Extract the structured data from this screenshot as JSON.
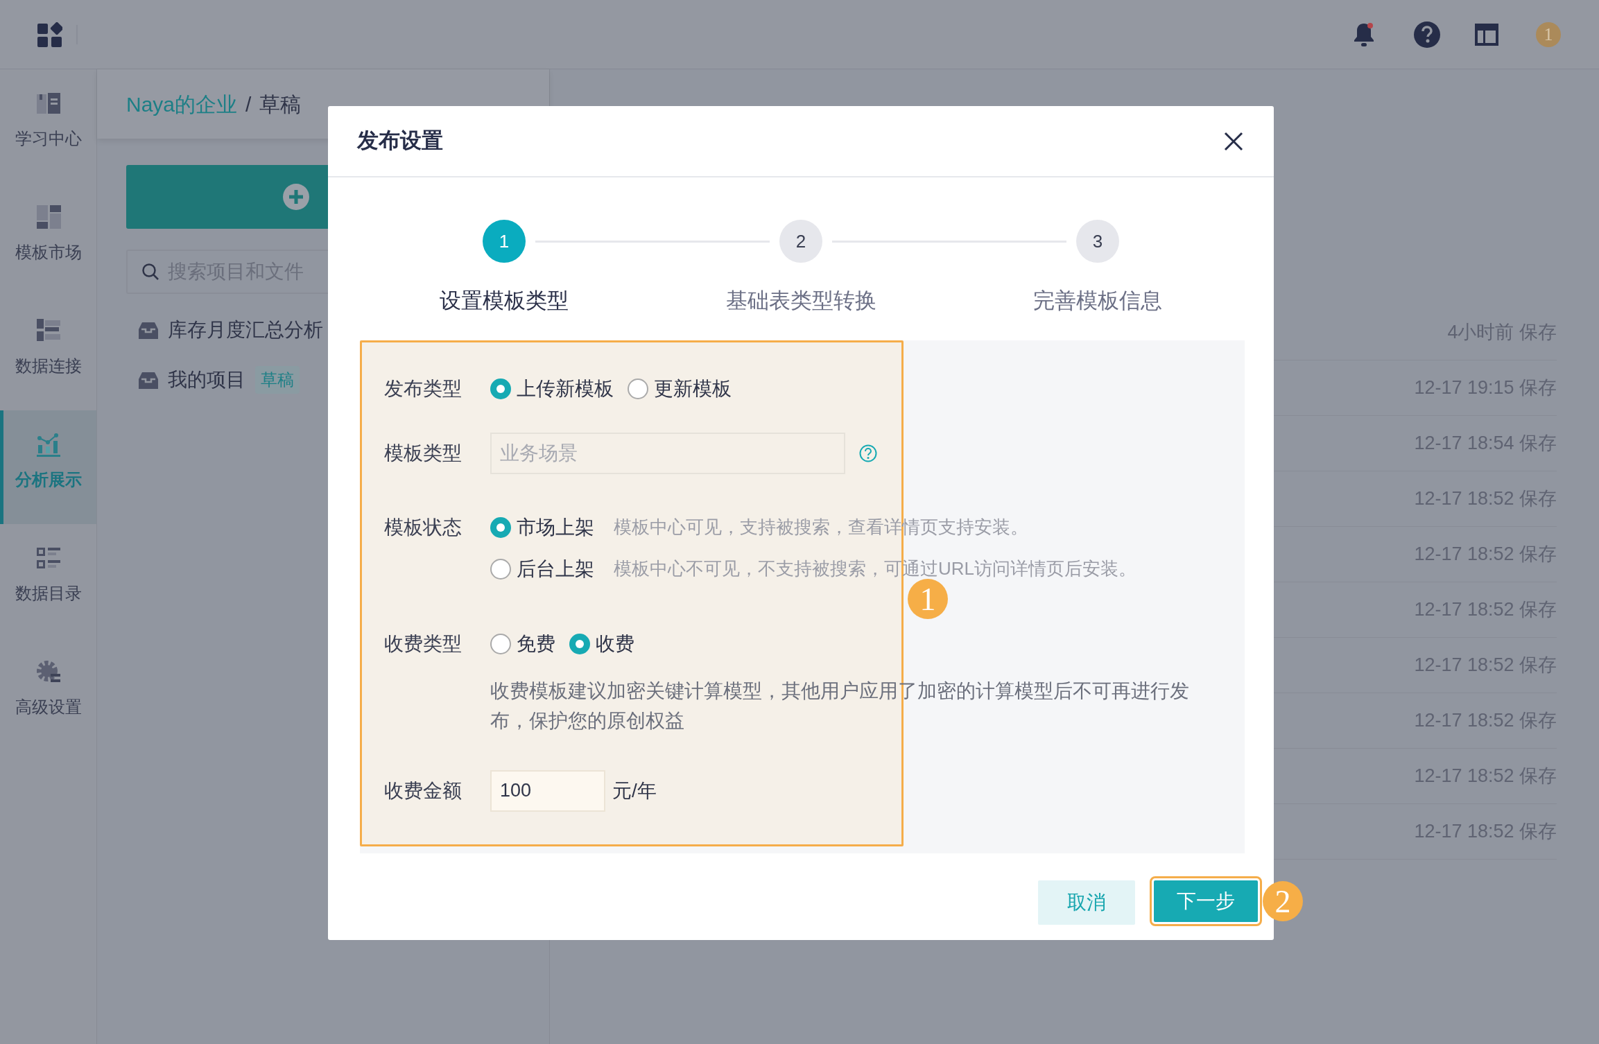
{
  "topbar": {
    "notice_badge": "1"
  },
  "sidebar": {
    "items": [
      {
        "label": "学习中心",
        "selected": false,
        "kind": "book"
      },
      {
        "label": "模板市场",
        "selected": false,
        "kind": "blocks"
      },
      {
        "label": "数据连接",
        "selected": false,
        "kind": "link"
      },
      {
        "label": "分析展示",
        "selected": true,
        "kind": "chart"
      },
      {
        "label": "数据目录",
        "selected": false,
        "kind": "list"
      },
      {
        "label": "高级设置",
        "selected": false,
        "kind": "gear"
      }
    ]
  },
  "breadcrumb": {
    "root": "Naya的企业",
    "separator": "/",
    "current": "草稿"
  },
  "search": {
    "placeholder": "搜索项目和文件"
  },
  "projects": [
    {
      "name": "库存月度汇总分析"
    },
    {
      "name": "我的项目",
      "tag": "草稿"
    }
  ],
  "saves": [
    "4小时前 保存",
    "12-17 19:15 保存",
    "12-17 18:54 保存",
    "12-17 18:52 保存",
    "12-17 18:52 保存",
    "12-17 18:52 保存",
    "12-17 18:52 保存",
    "12-17 18:52 保存",
    "12-17 18:52 保存",
    "12-17 18:52 保存"
  ],
  "dialog": {
    "title": "发布设置",
    "steps": [
      {
        "number": "1",
        "label": "设置模板类型",
        "selected": true
      },
      {
        "number": "2",
        "label": "基础表类型转换",
        "selected": false
      },
      {
        "number": "3",
        "label": "完善模板信息",
        "selected": false
      }
    ],
    "publish_type": {
      "label": "发布类型",
      "options": [
        {
          "label": "上传新模板",
          "selected": true
        },
        {
          "label": "更新模板",
          "selected": false
        }
      ]
    },
    "template_type": {
      "label": "模板类型",
      "placeholder": "业务场景"
    },
    "template_status": {
      "label": "模板状态",
      "options": [
        {
          "label": "市场上架",
          "description": "模板中心可见，支持被搜索，查看详情页支持安装。",
          "selected": true
        },
        {
          "label": "后台上架",
          "description": "模板中心不可见，不支持被搜索，可通过URL访问详情页后安装。",
          "selected": false
        }
      ]
    },
    "fee_type": {
      "label": "收费类型",
      "options": [
        {
          "label": "免费",
          "selected": false
        },
        {
          "label": "收费",
          "selected": true
        }
      ],
      "note": "收费模板建议加密关键计算模型，其他用户应用了加密的计算模型后不可再进行发布，保护您的原创权益"
    },
    "fee_amount": {
      "label": "收费金额",
      "value": "100",
      "unit": "元/年"
    },
    "buttons": {
      "cancel": "取消",
      "next": "下一步"
    }
  },
  "annotations": [
    "1",
    "2"
  ]
}
